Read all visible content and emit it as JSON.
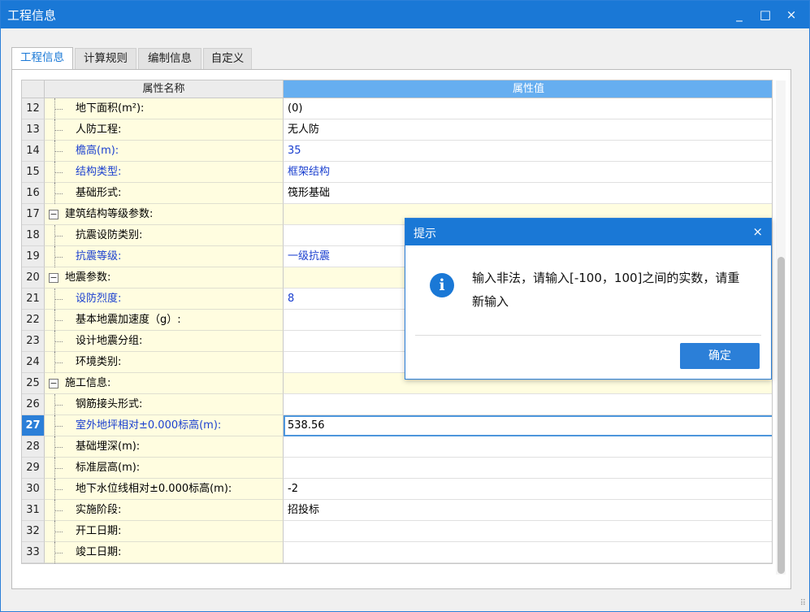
{
  "window": {
    "title": "工程信息",
    "minimize": "_",
    "maximize": "□",
    "close": "×"
  },
  "tabs": [
    "工程信息",
    "计算规则",
    "编制信息",
    "自定义"
  ],
  "grid": {
    "headers": {
      "name": "属性名称",
      "value": "属性值"
    },
    "rows": [
      {
        "idx": "12",
        "name": "地下面积(m²):",
        "value": "(0)"
      },
      {
        "idx": "13",
        "name": "人防工程:",
        "value": "无人防"
      },
      {
        "idx": "14",
        "name": "檐高(m):",
        "value": "35"
      },
      {
        "idx": "15",
        "name": "结构类型:",
        "value": "框架结构"
      },
      {
        "idx": "16",
        "name": "基础形式:",
        "value": "筏形基础"
      },
      {
        "idx": "17",
        "name": "建筑结构等级参数:",
        "value": ""
      },
      {
        "idx": "18",
        "name": "抗震设防类别:",
        "value": ""
      },
      {
        "idx": "19",
        "name": "抗震等级:",
        "value": "一级抗震"
      },
      {
        "idx": "20",
        "name": "地震参数:",
        "value": ""
      },
      {
        "idx": "21",
        "name": "设防烈度:",
        "value": "8"
      },
      {
        "idx": "22",
        "name": "基本地震加速度（g）:",
        "value": ""
      },
      {
        "idx": "23",
        "name": "设计地震分组:",
        "value": ""
      },
      {
        "idx": "24",
        "name": "环境类别:",
        "value": ""
      },
      {
        "idx": "25",
        "name": "施工信息:",
        "value": ""
      },
      {
        "idx": "26",
        "name": "钢筋接头形式:",
        "value": ""
      },
      {
        "idx": "27",
        "name": "室外地坪相对±0.000标高(m):",
        "value": "538.56"
      },
      {
        "idx": "28",
        "name": "基础埋深(m):",
        "value": ""
      },
      {
        "idx": "29",
        "name": "标准层高(m):",
        "value": ""
      },
      {
        "idx": "30",
        "name": "地下水位线相对±0.000标高(m):",
        "value": "-2"
      },
      {
        "idx": "31",
        "name": "实施阶段:",
        "value": "招投标"
      },
      {
        "idx": "32",
        "name": "开工日期:",
        "value": ""
      },
      {
        "idx": "33",
        "name": "竣工日期:",
        "value": ""
      }
    ]
  },
  "dialog": {
    "title": "提示",
    "close": "×",
    "icon": "info-icon",
    "icon_glyph": "i",
    "message": "输入非法，请输入[-100，100]之间的实数，请重新输入",
    "ok_label": "确定"
  },
  "colors": {
    "accent": "#1a78d6",
    "header_value": "#66aef0",
    "name_cell": "#fffde0",
    "blue_text": "#1a3fcf"
  }
}
